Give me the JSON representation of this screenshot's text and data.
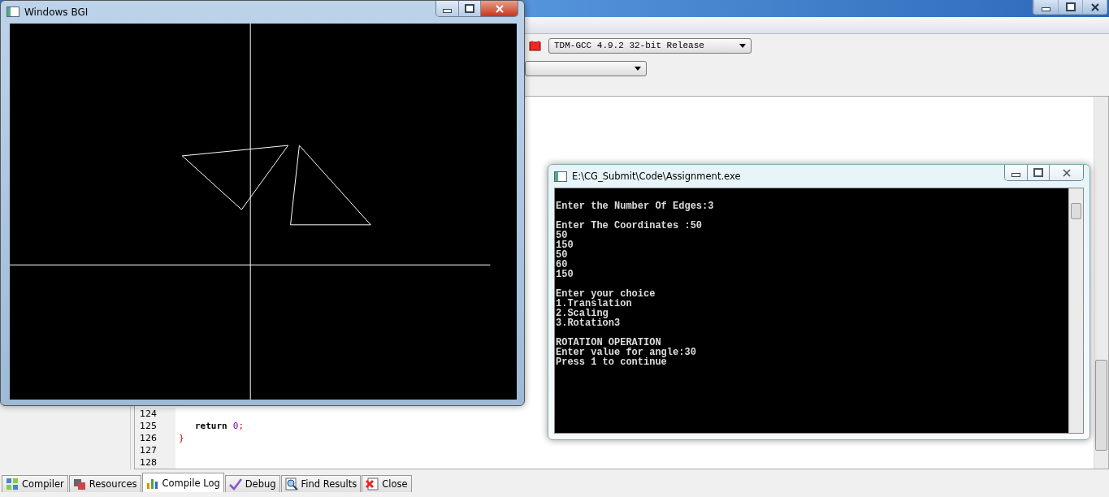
{
  "ide": {
    "compiler_select": "TDM-GCC 4.9.2 32-bit Release",
    "code_lines": [
      {
        "number": "124"
      },
      {
        "number": "125",
        "tokens": [
          {
            "text": "return",
            "kind": "keyword"
          },
          {
            "text": "0",
            "kind": "number"
          },
          {
            "text": ";",
            "kind": "symbol"
          }
        ]
      },
      {
        "number": "126",
        "tokens": [
          {
            "text": "}",
            "kind": "symbol"
          }
        ]
      },
      {
        "number": "127"
      },
      {
        "number": "128"
      }
    ],
    "bottom_tabs": [
      {
        "label": "Compiler",
        "selected": false
      },
      {
        "label": "Resources",
        "selected": false
      },
      {
        "label": "Compile Log",
        "selected": true
      },
      {
        "label": "Debug",
        "selected": false
      },
      {
        "label": "Find Results",
        "selected": false
      },
      {
        "label": "Close",
        "selected": false
      }
    ]
  },
  "bgi_window": {
    "title": "Windows BGI"
  },
  "console_window": {
    "title": "E:\\CG_Submit\\Code\\Assignment.exe",
    "blocks": [
      [
        "Enter the Number Of Edges:3"
      ],
      [
        "Enter The Coordinates :50",
        "50",
        "150",
        "50",
        "60",
        "150"
      ],
      [
        "Enter your choice",
        "1.Translation",
        "2.Scaling",
        "3.Rotation3"
      ],
      [
        "ROTATION OPERATION",
        "Enter value for angle:30",
        "Press 1 to continue"
      ]
    ]
  }
}
